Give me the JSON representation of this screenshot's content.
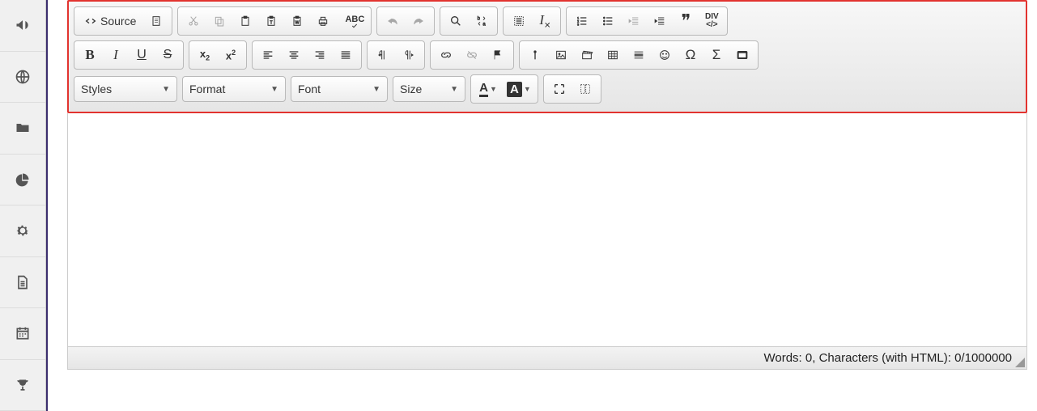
{
  "sidebar": {
    "items": [
      "bullhorn",
      "globe",
      "folder",
      "pie-chart",
      "gear",
      "file",
      "calendar",
      "trophy"
    ]
  },
  "toolbar": {
    "source_label": "Source",
    "combos": {
      "styles": "Styles",
      "format": "Format",
      "font": "Font",
      "size": "Size"
    },
    "abc": "ABC",
    "div": "DIV",
    "bold": "B",
    "italic": "I",
    "under": "U",
    "strike": "S",
    "sub_x": "x",
    "sup_x": "x",
    "color_a": "A",
    "bg_a": "A"
  },
  "status": {
    "text": "Words: 0, Characters (with HTML): 0/1000000"
  }
}
